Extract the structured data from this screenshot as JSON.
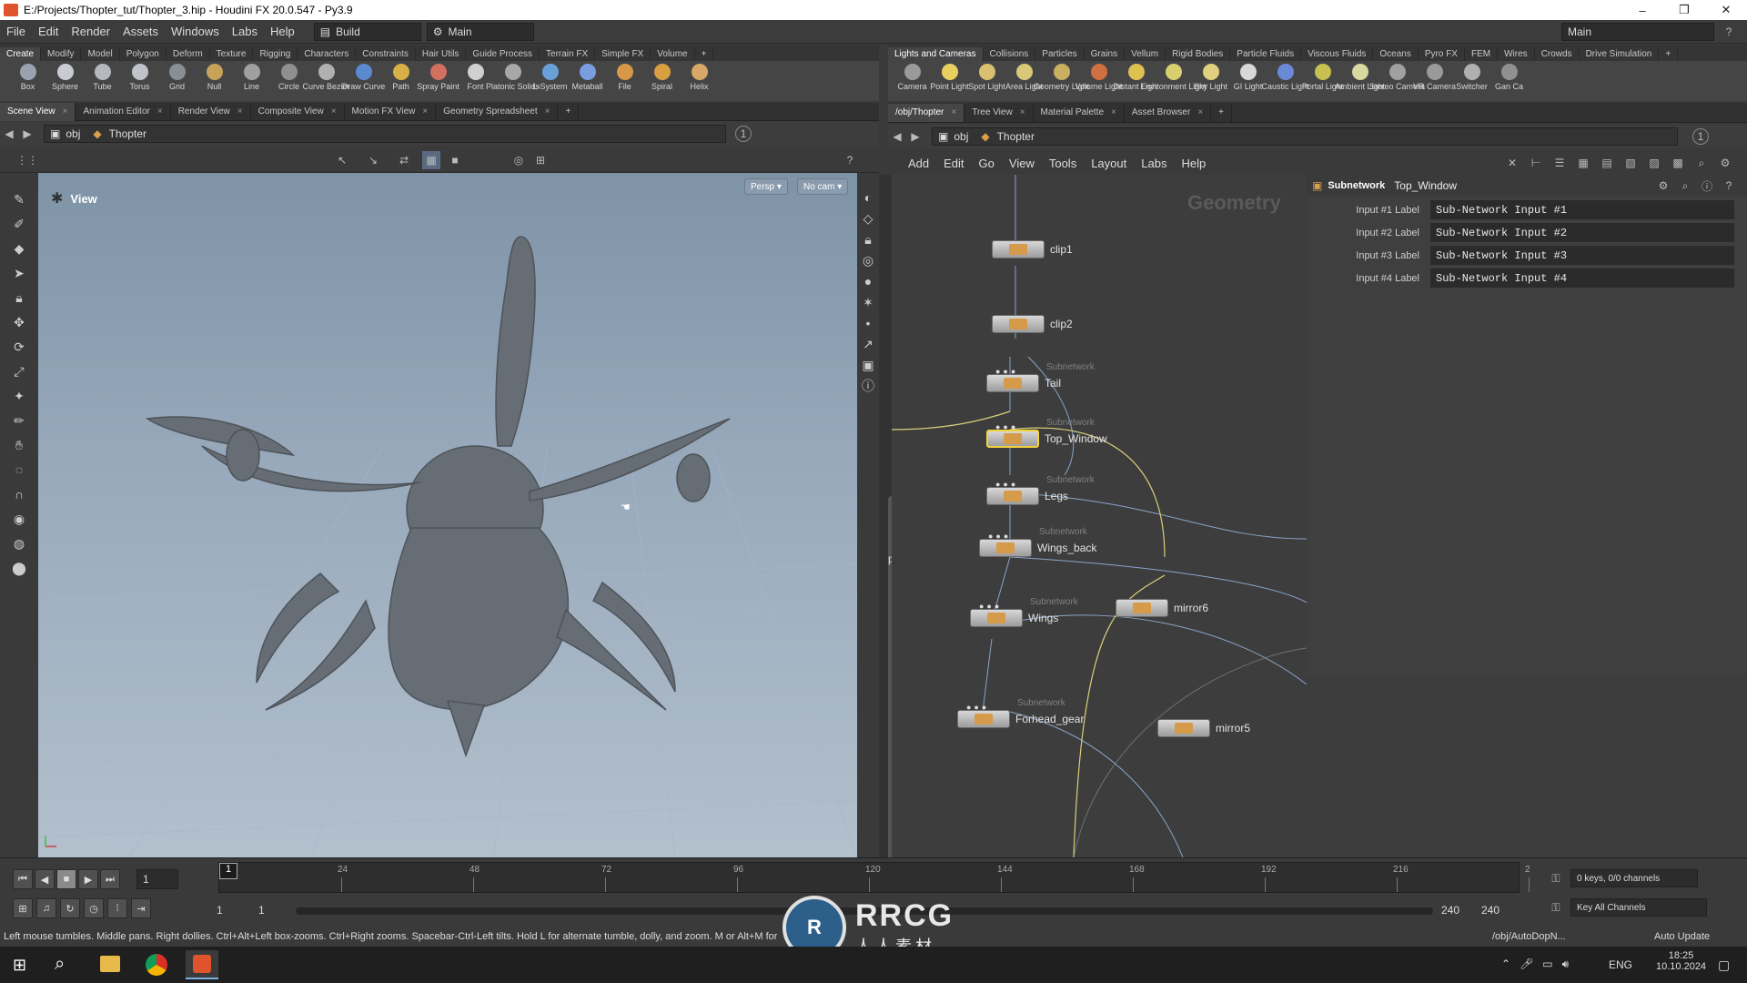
{
  "window": {
    "title": "E:/Projects/Thopter_tut/Thopter_3.hip - Houdini FX 20.0.547 - Py3.9",
    "min": "–",
    "max": "❐",
    "close": "✕"
  },
  "menu": [
    "File",
    "Edit",
    "Render",
    "Assets",
    "Windows",
    "Labs",
    "Help"
  ],
  "desktop_combo": "Build",
  "main_combo": "Main",
  "right_main_combo": "Main",
  "left_shelf_tabs": [
    "Create",
    "Modify",
    "Model",
    "Polygon",
    "Deform",
    "Texture",
    "Rigging",
    "Characters",
    "Constraints",
    "Hair Utils",
    "Guide Process",
    "Terrain FX",
    "Simple FX",
    "Volume"
  ],
  "left_tools": [
    {
      "label": "Box",
      "color": "#9aa3ad"
    },
    {
      "label": "Sphere",
      "color": "#c8ccd2"
    },
    {
      "label": "Tube",
      "color": "#b4b9c0"
    },
    {
      "label": "Torus",
      "color": "#c0c4ca"
    },
    {
      "label": "Grid",
      "color": "#8a8f96"
    },
    {
      "label": "Null",
      "color": "#c9a25a"
    },
    {
      "label": "Line",
      "color": "#a0a0a0"
    },
    {
      "label": "Circle",
      "color": "#8f8f8f"
    },
    {
      "label": "Curve Bezier",
      "color": "#b0b0b0"
    },
    {
      "label": "Draw Curve",
      "color": "#5a8ad0"
    },
    {
      "label": "Path",
      "color": "#d8b048"
    },
    {
      "label": "Spray Paint",
      "color": "#d27060"
    },
    {
      "label": "Font",
      "color": "#d0d0d0"
    },
    {
      "label": "Platonic Solids",
      "color": "#a8a8a8"
    },
    {
      "label": "L-System",
      "color": "#6aa0d8"
    },
    {
      "label": "Metaball",
      "color": "#7a9ce0"
    },
    {
      "label": "File",
      "color": "#d89848"
    },
    {
      "label": "Spiral",
      "color": "#d8a040"
    },
    {
      "label": "Helix",
      "color": "#d8a868"
    }
  ],
  "right_shelf_tabs": [
    "Lights and Cameras",
    "Collisions",
    "Particles",
    "Grains",
    "Vellum",
    "Rigid Bodies",
    "Particle Fluids",
    "Viscous Fluids",
    "Oceans",
    "Pyro FX",
    "FEM",
    "Wires",
    "Crowds",
    "Drive Simulation"
  ],
  "right_tools": [
    {
      "label": "Camera",
      "color": "#9a9a9a"
    },
    {
      "label": "Point Light",
      "color": "#e8d060"
    },
    {
      "label": "Spot Light",
      "color": "#d8c070"
    },
    {
      "label": "Area Light",
      "color": "#d8c878"
    },
    {
      "label": "Geometry Light",
      "color": "#c8b060"
    },
    {
      "label": "Volume Light",
      "color": "#d07040"
    },
    {
      "label": "Distant Light",
      "color": "#e0c050"
    },
    {
      "label": "Environment Light",
      "color": "#d8d070"
    },
    {
      "label": "Sky Light",
      "color": "#e0d080"
    },
    {
      "label": "GI Light",
      "color": "#d8d8d8"
    },
    {
      "label": "Caustic Light",
      "color": "#6a8ad8"
    },
    {
      "label": "Portal Light",
      "color": "#c8c050"
    },
    {
      "label": "Ambient Light",
      "color": "#d8d8a0"
    },
    {
      "label": "Stereo Camera",
      "color": "#a0a0a0"
    },
    {
      "label": "VR Camera",
      "color": "#9a9a9a"
    },
    {
      "label": "Switcher",
      "color": "#b0b0b0"
    },
    {
      "label": "Gan Ca",
      "color": "#909090"
    }
  ],
  "left_pane_tabs": [
    "Scene View",
    "Animation Editor",
    "Render View",
    "Composite View",
    "Motion FX View",
    "Geometry Spreadsheet"
  ],
  "right_pane_tabs": [
    "/obj/Thopter",
    "Tree View",
    "Material Palette",
    "Asset Browser"
  ],
  "left_path": {
    "root": "obj",
    "node": "Thopter"
  },
  "right_path": {
    "root": "obj",
    "node": "Thopter"
  },
  "viewport": {
    "label": "View",
    "persp": "Persp ▾",
    "cam": "No cam ▾"
  },
  "net_menu": [
    "Add",
    "Edit",
    "Go",
    "View",
    "Tools",
    "Layout",
    "Labs",
    "Help"
  ],
  "net_context": "Geometry",
  "side_label": "phere",
  "nodes": [
    {
      "name": "clip1",
      "type": ""
    },
    {
      "name": "clip2",
      "type": ""
    },
    {
      "name": "Tail",
      "type": "Subnetwork"
    },
    {
      "name": "Top_Window",
      "type": "Subnetwork"
    },
    {
      "name": "Legs",
      "type": "Subnetwork"
    },
    {
      "name": "Wings_back",
      "type": "Subnetwork"
    },
    {
      "name": "Wings",
      "type": "Subnetwork"
    },
    {
      "name": "Forhead_gear",
      "type": "Subnetwork"
    },
    {
      "name": "mirror6",
      "type": ""
    },
    {
      "name": "mirror5",
      "type": ""
    }
  ],
  "params": {
    "op_type": "Subnetwork",
    "op_name": "Top_Window",
    "rows": [
      {
        "label": "Input #1 Label",
        "value": "Sub-Network Input #1"
      },
      {
        "label": "Input #2 Label",
        "value": "Sub-Network Input #2"
      },
      {
        "label": "Input #3 Label",
        "value": "Sub-Network Input #3"
      },
      {
        "label": "Input #4 Label",
        "value": "Sub-Network Input #4"
      }
    ]
  },
  "timeline": {
    "frame": "1",
    "ticks": [
      "24",
      "48",
      "72",
      "96",
      "120",
      "144",
      "168",
      "192",
      "216",
      "2"
    ],
    "start": "1",
    "start2": "1",
    "end": "240",
    "end2": "240",
    "keys": "0 keys, 0/0 channels",
    "key_all": "Key All Channels",
    "current": "1"
  },
  "status": {
    "text": "Left mouse tumbles. Middle pans. Right dollies. Ctrl+Alt+Left box-zooms. Ctrl+Right zooms. Spacebar-Ctrl-Left tilts. Hold L for alternate tumble, dolly, and zoom. M or Alt+M for",
    "path": "/obj/AutoDopN...",
    "update": "Auto Update"
  },
  "watermark": {
    "title": "RRCG",
    "sub": "人人素材"
  },
  "taskbar": {
    "lang": "ENG",
    "time": "18:25",
    "date": "10.10.2024"
  }
}
